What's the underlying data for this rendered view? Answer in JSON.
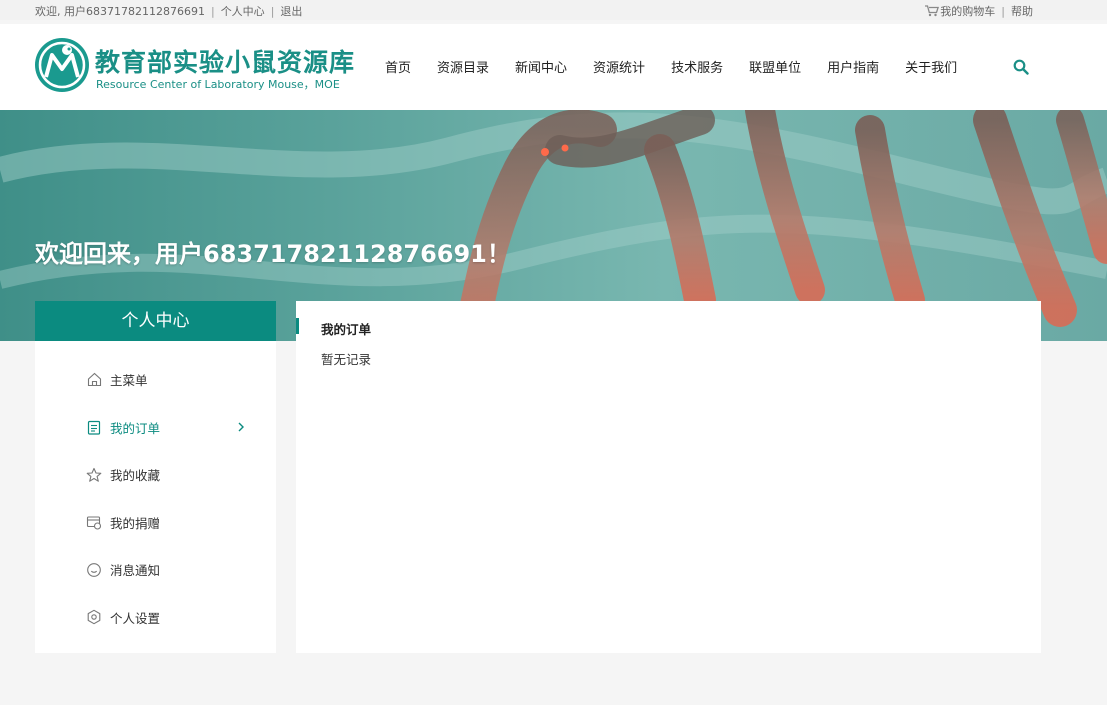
{
  "topbar": {
    "welcome": "欢迎, 用户68371782112876691",
    "profile_link": "个人中心",
    "logout_link": "退出",
    "cart_link": "我的购物车",
    "help_link": "帮助"
  },
  "header": {
    "logo_cn": "教育部实验小鼠资源库",
    "logo_en": "Resource Center of Laboratory Mouse，MOE",
    "nav": [
      "首页",
      "资源目录",
      "新闻中心",
      "资源统计",
      "技术服务",
      "联盟单位",
      "用户指南",
      "关于我们"
    ]
  },
  "banner": {
    "welcome": "欢迎回来，用户68371782112876691！"
  },
  "sidebar": {
    "title": "个人中心",
    "items": [
      {
        "label": "主菜单",
        "icon": "home-icon"
      },
      {
        "label": "我的订单",
        "icon": "order-icon"
      },
      {
        "label": "我的收藏",
        "icon": "star-icon"
      },
      {
        "label": "我的捐赠",
        "icon": "donate-icon"
      },
      {
        "label": "消息通知",
        "icon": "message-icon"
      },
      {
        "label": "个人设置",
        "icon": "settings-icon"
      }
    ]
  },
  "main": {
    "title": "我的订单",
    "empty_text": "暂无记录"
  },
  "colors": {
    "accent": "#0b8b80",
    "brand": "#1a8f86"
  }
}
